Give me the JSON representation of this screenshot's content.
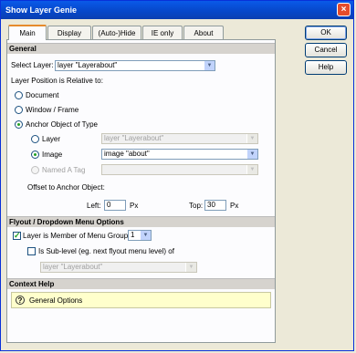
{
  "window": {
    "title": "Show Layer Genie",
    "close_glyph": "×"
  },
  "tabs": [
    {
      "label": "Main"
    },
    {
      "label": "Display"
    },
    {
      "label": "(Auto-)Hide"
    },
    {
      "label": "IE only"
    },
    {
      "label": "About"
    }
  ],
  "buttons": {
    "ok": "OK",
    "cancel": "Cancel",
    "help": "Help"
  },
  "general": {
    "heading": "General",
    "select_layer_label": "Select Layer:",
    "select_layer_value": "layer \"Layerabout\"",
    "position_label": "Layer Position is Relative to:",
    "options": {
      "document": "Document",
      "window": "Window / Frame",
      "anchor": "Anchor Object of Type"
    },
    "anchor_types": {
      "layer": "Layer",
      "layer_value": "layer \"Layerabout\"",
      "image": "Image",
      "image_value": "image \"about\"",
      "named_a": "Named A Tag",
      "named_a_value": ""
    },
    "offset_label": "Offset to Anchor Object:",
    "left_label": "Left:",
    "left_value": "0",
    "left_unit": "Px",
    "top_label": "Top:",
    "top_value": "30",
    "top_unit": "Px"
  },
  "flyout": {
    "heading": "Flyout / Dropdown Menu Options",
    "member_label": "Layer is Member of Menu Group:",
    "member_checked": true,
    "group_value": "1",
    "sublevel_label": "Is Sub-level (eg. next flyout menu level) of",
    "sublevel_checked": false,
    "sublevel_value": "layer \"Layerabout\""
  },
  "context_help": {
    "heading": "Context Help",
    "icon_glyph": "?",
    "text": "General Options"
  },
  "glyphs": {
    "dropdown": "▼",
    "check": "✓"
  }
}
